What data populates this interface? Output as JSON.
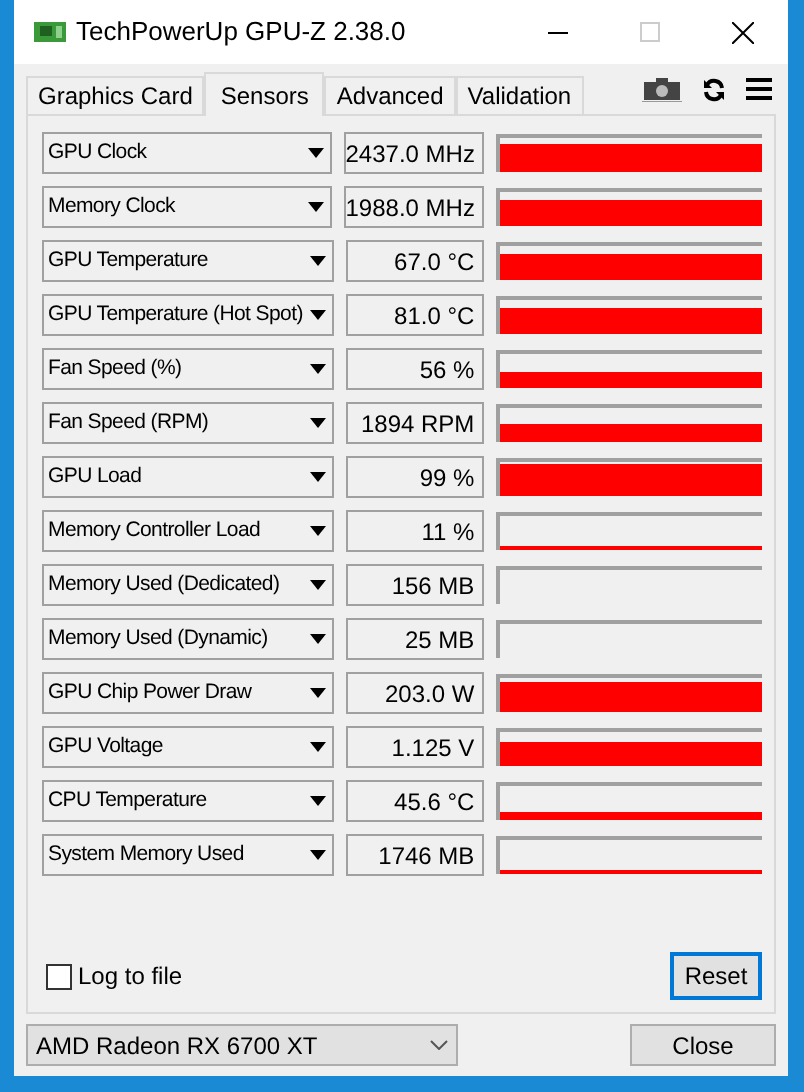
{
  "window": {
    "title": "TechPowerUp GPU-Z 2.38.0"
  },
  "tabs": [
    {
      "label": "Graphics Card",
      "selected": false
    },
    {
      "label": "Sensors",
      "selected": true
    },
    {
      "label": "Advanced",
      "selected": false
    },
    {
      "label": "Validation",
      "selected": false
    }
  ],
  "sensors": [
    {
      "name": "GPU Clock",
      "value": "2437.0 MHz"
    },
    {
      "name": "Memory Clock",
      "value": "1988.0 MHz"
    },
    {
      "name": "GPU Temperature",
      "value": "67.0 °C"
    },
    {
      "name": "GPU Temperature (Hot Spot)",
      "value": "81.0 °C"
    },
    {
      "name": "Fan Speed (%)",
      "value": "56 %"
    },
    {
      "name": "Fan Speed (RPM)",
      "value": "1894 RPM"
    },
    {
      "name": "GPU Load",
      "value": "99 %"
    },
    {
      "name": "Memory Controller Load",
      "value": "11 %"
    },
    {
      "name": "Memory Used (Dedicated)",
      "value": "156 MB"
    },
    {
      "name": "Memory Used (Dynamic)",
      "value": "25 MB"
    },
    {
      "name": "GPU Chip Power Draw",
      "value": "203.0 W"
    },
    {
      "name": "GPU Voltage",
      "value": "1.125 V"
    },
    {
      "name": "CPU Temperature",
      "value": "45.6 °C"
    },
    {
      "name": "System Memory Used",
      "value": "1746 MB"
    }
  ],
  "log_to_file": {
    "label": "Log to file",
    "checked": false
  },
  "reset_button": "Reset",
  "gpu_select": "AMD Radeon RX 6700 XT",
  "close_button": "Close"
}
